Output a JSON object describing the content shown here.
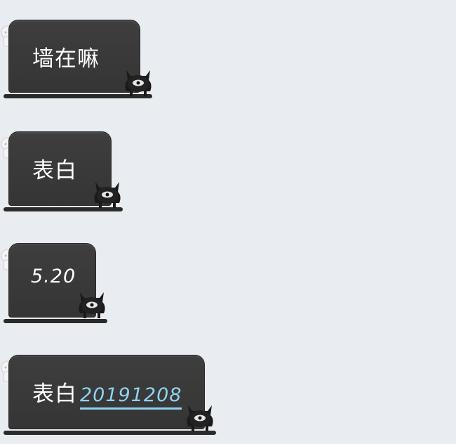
{
  "messages": [
    {
      "text": "墙在嘛"
    },
    {
      "text": "表白"
    },
    {
      "text": "5.20"
    },
    {
      "text": "表白",
      "link": "20191208"
    }
  ],
  "colors": {
    "background": "#e9ecf1",
    "bubble": "#3a3a3a",
    "link": "#8fd3ef"
  },
  "icons": {
    "avatar": "ghost-avatar-icon",
    "decoration": "one-eyed-monster-icon"
  }
}
